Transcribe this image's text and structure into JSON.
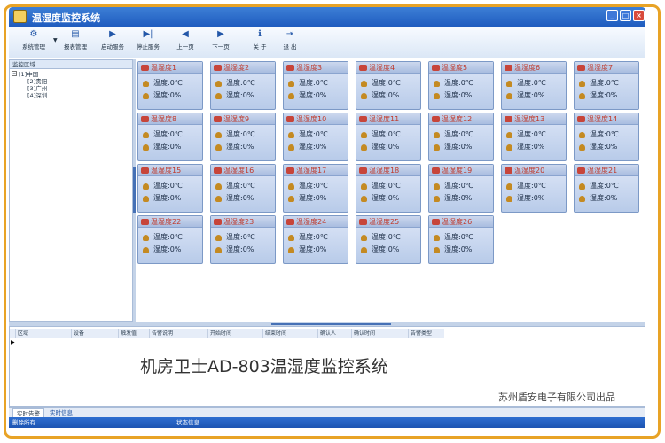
{
  "window": {
    "title": "温湿度监控系统",
    "controls": [
      "_",
      "□",
      "×"
    ]
  },
  "toolbar": {
    "items": [
      {
        "label": "系统管理",
        "icon": "gear-icon"
      },
      {
        "label": "报表管理",
        "icon": "report-icon"
      },
      {
        "label": "启动服务",
        "icon": "play-icon"
      },
      {
        "label": "停止服务",
        "icon": "stop-icon"
      },
      {
        "label": "上一页",
        "icon": "prev-page-icon"
      },
      {
        "label": "下一页",
        "icon": "next-page-icon"
      },
      {
        "label": "关 于",
        "icon": "info-icon"
      },
      {
        "label": "退 出",
        "icon": "exit-icon"
      }
    ]
  },
  "sidebar": {
    "title": "监控区域",
    "tree": {
      "root": "[1]中国",
      "children": [
        "[2]贵阳",
        "[3]广州",
        "[4]深圳"
      ]
    }
  },
  "sensors": {
    "temp_label": "温度:0℃",
    "humidity_label": "湿度:0%",
    "names": [
      "温湿度1",
      "温湿度2",
      "温湿度3",
      "温湿度4",
      "温湿度5",
      "温湿度6",
      "温湿度7",
      "温湿度8",
      "温湿度9",
      "温湿度10",
      "温湿度11",
      "温湿度12",
      "温湿度13",
      "温湿度14",
      "温湿度15",
      "温湿度16",
      "温湿度17",
      "温湿度18",
      "温湿度19",
      "温湿度20",
      "温湿度21",
      "温湿度22",
      "温湿度23",
      "温湿度24",
      "温湿度25",
      "温湿度26"
    ]
  },
  "alarm_table": {
    "columns": [
      "区域",
      "设备",
      "触发值",
      "告警说明",
      "开始时间",
      "结束时间",
      "确认人",
      "确认时间",
      "告警类型"
    ],
    "row_marker": "▶"
  },
  "overlay": {
    "product_title": "机房卫士AD-803温湿度监控系统",
    "company": "苏州盾安电子有限公司出品"
  },
  "tabs": [
    "实时告警",
    "实时信息"
  ],
  "status": {
    "left": "删除所有",
    "info": "状态信息"
  },
  "colors": {
    "frame": "#e8a326",
    "titlebar": "#2a6acb",
    "card_title": "#c0392b",
    "card_bg": "#c9d7ee"
  }
}
